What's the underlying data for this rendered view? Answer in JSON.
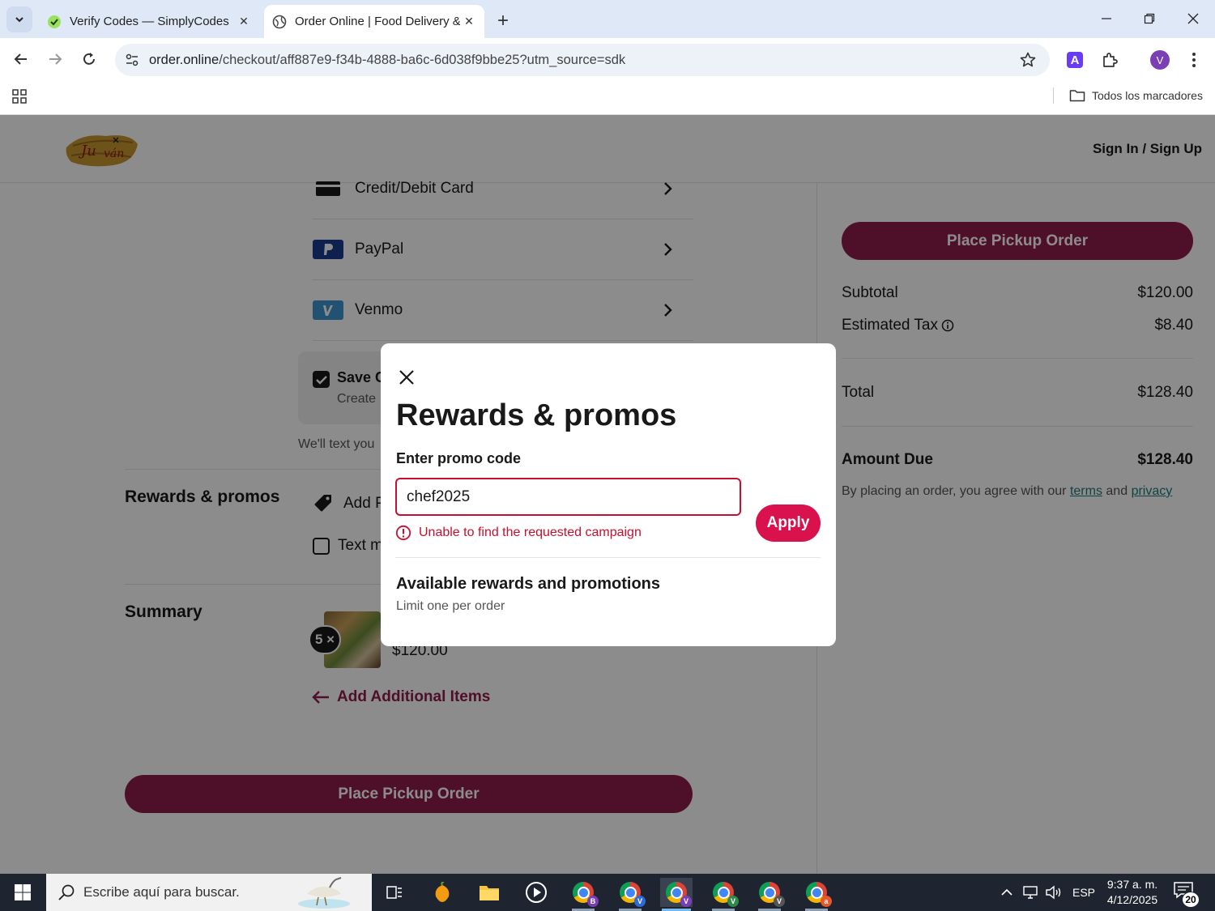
{
  "browser": {
    "tabs": [
      {
        "title": "Verify Codes — SimplyCodes",
        "active": false
      },
      {
        "title": "Order Online | Food Delivery &",
        "active": true
      }
    ],
    "url_host": "order.online",
    "url_path": "/checkout/aff887e9-f34b-4888-ba6c-6d038f9bbe25?utm_source=sdk",
    "profile_initial": "V",
    "extension_letter": "A",
    "bookmarks_all": "Todos los marcadores"
  },
  "header": {
    "signin": "Sign In / Sign Up"
  },
  "payment_methods": [
    {
      "label": "Credit/Debit Card",
      "icon": "credit-card-icon"
    },
    {
      "label": "PayPal",
      "icon": "paypal-icon"
    },
    {
      "label": "Venmo",
      "icon": "venmo-icon"
    }
  ],
  "save_card": {
    "title": "Save C",
    "subtitle": "Create",
    "checked": true
  },
  "text_note": "We'll text you",
  "rewards_section": {
    "title": "Rewards & promos",
    "add_label": "Add P",
    "text_label": "Text m"
  },
  "summary": {
    "title": "Summary",
    "item_qty": "5 ×",
    "item_price": "$120.00",
    "add_items": "Add Additional Items"
  },
  "place_order_label": "Place Pickup Order",
  "order_summary": {
    "subtotal_label": "Subtotal",
    "subtotal_value": "$120.00",
    "tax_label": "Estimated Tax",
    "tax_value": "$8.40",
    "total_label": "Total",
    "total_value": "$128.40",
    "due_label": "Amount Due",
    "due_value": "$128.40",
    "legal_prefix": "By placing an order, you agree with our",
    "legal_terms": "terms",
    "legal_and": "and",
    "legal_privacy": "privacy"
  },
  "modal": {
    "title": "Rewards & promos",
    "input_label": "Enter promo code",
    "input_value": "chef2025",
    "apply_label": "Apply",
    "error": "Unable to find the requested campaign",
    "available_title": "Available rewards and promotions",
    "available_sub": "Limit one per order"
  },
  "taskbar": {
    "search_placeholder": "Escribe aquí para buscar.",
    "language": "ESP",
    "time": "9:37 a. m.",
    "date": "4/12/2025",
    "notifications": "20",
    "chrome_profiles": [
      "B",
      "V",
      "V",
      "V",
      "V",
      "a"
    ]
  },
  "colors": {
    "brand": "#8f1d4a",
    "apply": "#d9114d",
    "error": "#c8102e"
  }
}
